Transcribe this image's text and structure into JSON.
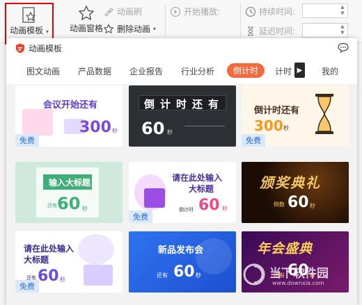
{
  "ribbon": {
    "template_label": "动画模板",
    "pane_label": "动画窗格",
    "brush_label": "动画刷",
    "delete_label": "删除动画",
    "start_label": "开始播放:",
    "duration_label": "持续时间:",
    "delay_label": "延迟时间:"
  },
  "panel": {
    "title": "动画模板",
    "tabs": [
      "图文动画",
      "产品数据",
      "企业报告",
      "行业分析",
      "倒计时",
      "计时",
      "我的"
    ],
    "active_tab": "倒计时"
  },
  "cards": [
    {
      "line1": "会议开始还有",
      "number": "300",
      "unit": "秒",
      "badge": "免费"
    },
    {
      "line1": "倒计时还有",
      "number": "60",
      "unit": "秒"
    },
    {
      "line1": "倒计时还有",
      "number": "300",
      "unit": "秒",
      "badge": "免费"
    },
    {
      "line1": "输入大标题",
      "number": "60",
      "unit": "秒",
      "small": "还有"
    },
    {
      "line1": "请在此处输入",
      "line2": "大标题",
      "number": "60",
      "unit": "秒",
      "small": "倒计时",
      "badge": "免费"
    },
    {
      "line1": "颁奖典礼",
      "number": "60",
      "unit": "秒",
      "small": "倒数"
    },
    {
      "line1": "请在此处输入",
      "line2": "大标题",
      "number": "60",
      "unit": "秒",
      "small": "还有",
      "badge": "免费"
    },
    {
      "line1": "新品发布会",
      "number": "60",
      "unit": "秒",
      "small": "还有"
    },
    {
      "line1": "年会盛典",
      "number": "60",
      "unit": "秒",
      "small": "还有"
    }
  ],
  "watermark": {
    "text": "当下软件园",
    "url": "www.downxia.com"
  },
  "colors": {
    "accent": "#f26a3d",
    "highlight_border": "#e60000",
    "badge_text": "#2f6fd6"
  }
}
